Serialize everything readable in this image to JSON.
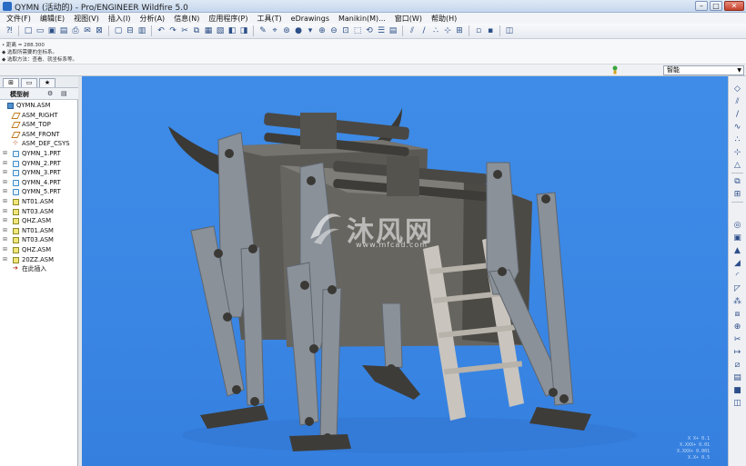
{
  "window": {
    "title": "QYMN (活动的) - Pro/ENGINEER Wildfire 5.0",
    "controls": [
      "–",
      "□",
      "✕"
    ]
  },
  "menu": [
    "文件(F)",
    "编辑(E)",
    "视图(V)",
    "插入(I)",
    "分析(A)",
    "信息(N)",
    "应用程序(P)",
    "工具(T)",
    "eDrawings",
    "Manikin(M)...",
    "窗口(W)",
    "帮助(H)"
  ],
  "messages": [
    "• 距离 = 288.300",
    "◆ 选取所需要的坐标系。",
    "◆ 选取方法：查看、就坐标系等。"
  ],
  "status": {
    "filter_value": "智能"
  },
  "navigator": {
    "tree_label": "模型树",
    "items": [
      {
        "label": "QYMN.ASM",
        "kind": "asm",
        "indent": 0,
        "expander": ""
      },
      {
        "label": "ASM_RIGHT",
        "kind": "plane",
        "indent": 1,
        "expander": ""
      },
      {
        "label": "ASM_TOP",
        "kind": "plane",
        "indent": 1,
        "expander": ""
      },
      {
        "label": "ASM_FRONT",
        "kind": "plane",
        "indent": 1,
        "expander": ""
      },
      {
        "label": "ASM_DEF_CSYS",
        "kind": "csys",
        "indent": 1,
        "expander": ""
      },
      {
        "label": "QYMN_1.PRT",
        "kind": "prt",
        "indent": 1,
        "expander": "⊞"
      },
      {
        "label": "QYMN_2.PRT",
        "kind": "prt",
        "indent": 1,
        "expander": "⊞"
      },
      {
        "label": "QYMN_3.PRT",
        "kind": "prt",
        "indent": 1,
        "expander": "⊞"
      },
      {
        "label": "QYMN_4.PRT",
        "kind": "prt",
        "indent": 1,
        "expander": "⊞"
      },
      {
        "label": "QYMN_5.PRT",
        "kind": "prt",
        "indent": 1,
        "expander": "⊞"
      },
      {
        "label": "NT01.ASM",
        "kind": "sub",
        "indent": 1,
        "expander": "⊞"
      },
      {
        "label": "NT03.ASM",
        "kind": "sub",
        "indent": 1,
        "expander": "⊞"
      },
      {
        "label": "QHZ.ASM",
        "kind": "sub",
        "indent": 1,
        "expander": "⊞"
      },
      {
        "label": "NT01.ASM",
        "kind": "sub",
        "indent": 1,
        "expander": "⊞"
      },
      {
        "label": "NT03.ASM",
        "kind": "sub",
        "indent": 1,
        "expander": "⊞"
      },
      {
        "label": "QHZ.ASM",
        "kind": "sub",
        "indent": 1,
        "expander": "⊞"
      },
      {
        "label": "20ZZ.ASM",
        "kind": "sub",
        "indent": 1,
        "expander": "⊞"
      },
      {
        "label": "在此插入",
        "kind": "insert",
        "indent": 1,
        "expander": ""
      }
    ]
  },
  "viewport": {
    "watermark_text": "沐风网",
    "watermark_url": "www.mfcad.com",
    "readout": "X X+ 0.1\nX.XXX+ 0.01\nX.XXX+ 0.001\nX.X+ 0.5"
  },
  "colors": {
    "viewport_bg": "#3a86e4",
    "model_body": "#5f5d58",
    "model_body_dark": "#3d3b37",
    "model_legs": "#8c939a",
    "model_ladder": "#c9c4bd"
  }
}
